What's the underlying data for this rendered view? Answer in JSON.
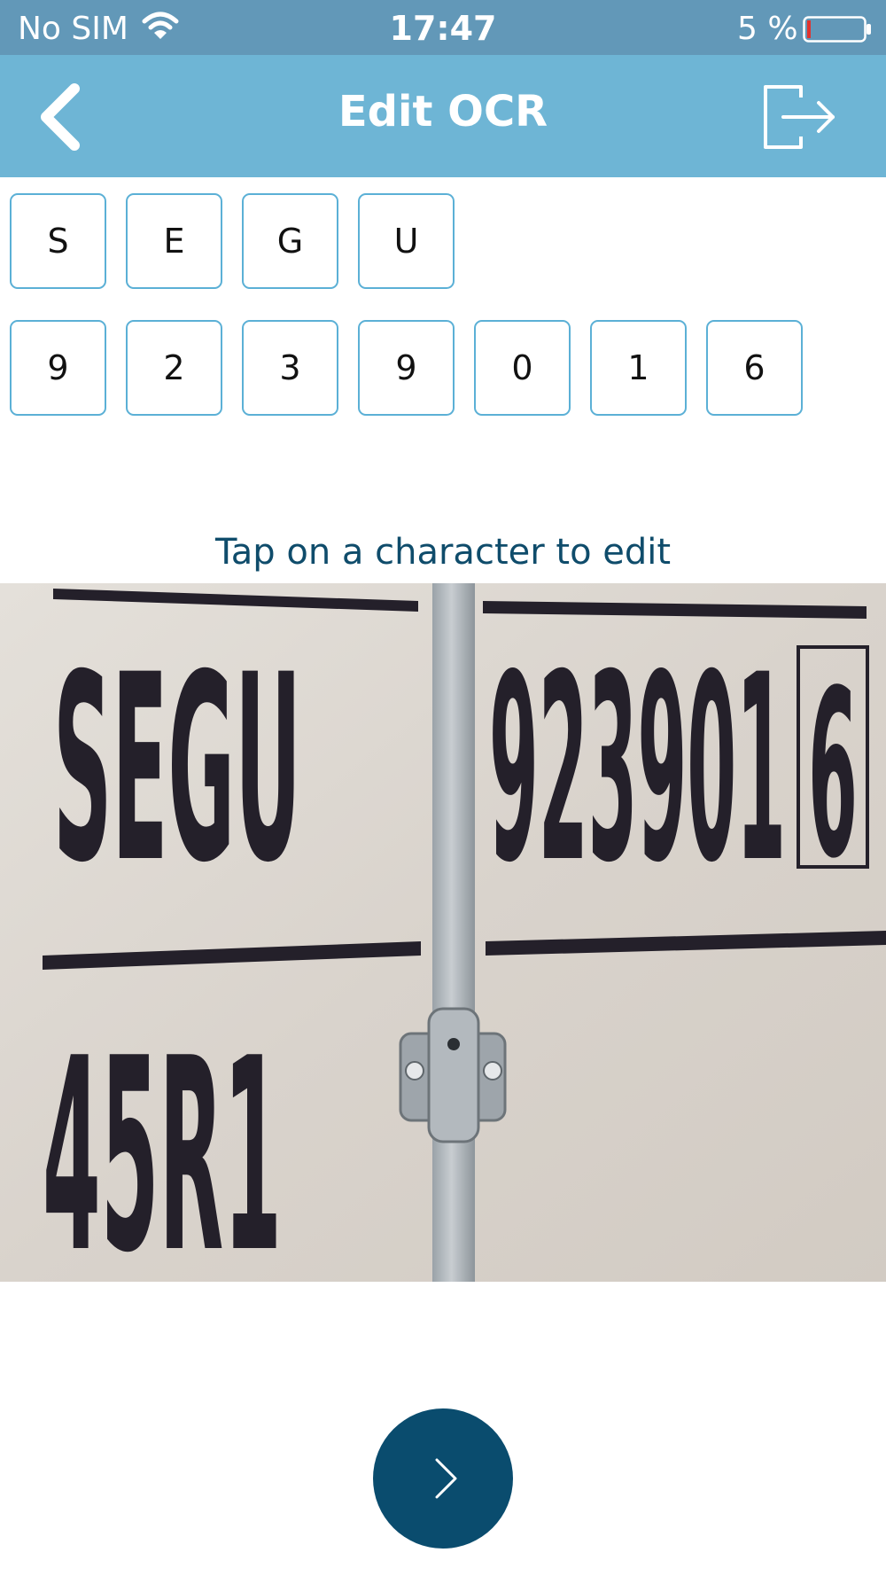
{
  "status_bar": {
    "carrier": "No SIM",
    "time": "17:47",
    "battery_percent": "5 %",
    "battery_level": 0.05
  },
  "nav": {
    "title": "Edit OCR",
    "back_icon": "chevron-left-icon",
    "logout_icon": "logout-icon"
  },
  "owner_code": [
    "S",
    "E",
    "G",
    "U"
  ],
  "serial_number": [
    "9",
    "2",
    "3",
    "9",
    "0",
    "1",
    "6"
  ],
  "hint": "Tap on a character to edit",
  "photo": {
    "owner_text": "SEGU",
    "serial_text": "923901",
    "check_digit": "6",
    "size_type": "45R1"
  },
  "colors": {
    "status_bar": "#6298b8",
    "nav_bar": "#6eb5d5",
    "box_border": "#5bb0d6",
    "hint_text": "#0f4c6b",
    "next_button": "#0a4c6e"
  },
  "next_button_icon": "chevron-right-icon"
}
